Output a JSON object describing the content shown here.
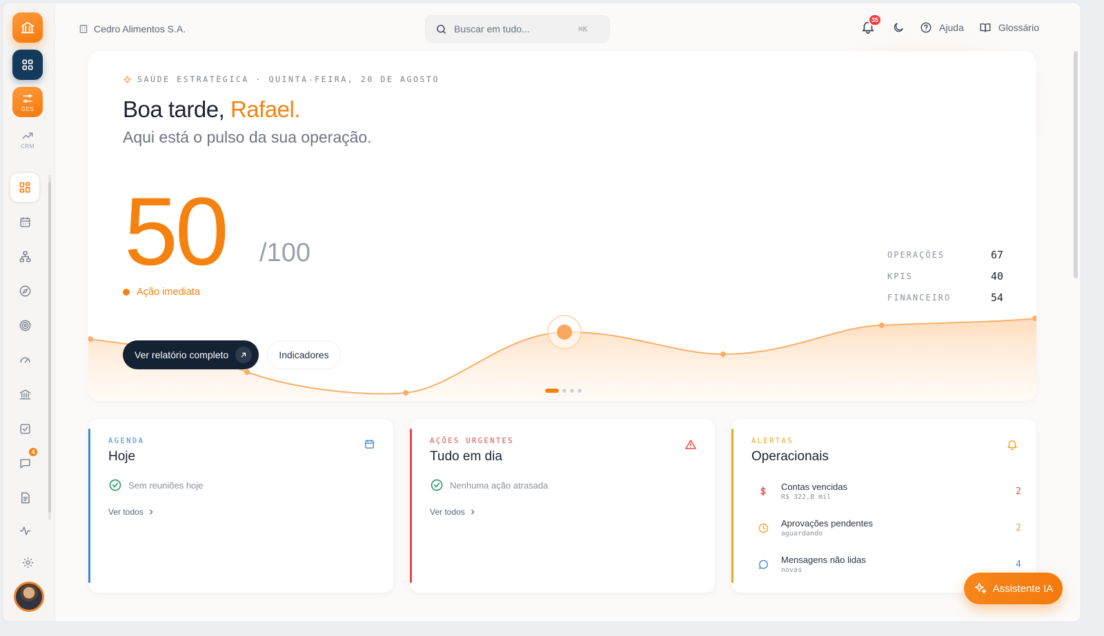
{
  "colors": {
    "accent": "#f5820f",
    "navy": "#163a5c",
    "agenda": "#3b8bd8",
    "urgent": "#e24a4a",
    "alerts": "#e8a72a",
    "success": "#2c9a6a"
  },
  "rail": {
    "ges_label": "GES",
    "crm_label": "CRM",
    "nav_items": [
      {
        "icon": "dashboard-icon"
      },
      {
        "icon": "calendar-icon"
      },
      {
        "icon": "org-chart-icon"
      },
      {
        "icon": "compass-icon"
      },
      {
        "icon": "target-icon"
      },
      {
        "icon": "gauge-icon"
      },
      {
        "icon": "bank-icon"
      },
      {
        "icon": "checkbox-icon"
      },
      {
        "icon": "chat-icon",
        "badge": "4"
      },
      {
        "icon": "document-icon"
      },
      {
        "icon": "activity-icon"
      }
    ]
  },
  "topbar": {
    "company": "Cedro Alimentos S.A.",
    "search_placeholder": "Buscar em tudo...",
    "search_shortcut": "⌘K",
    "notifications_count": "35",
    "help_label": "Ajuda",
    "glossary_label": "Glossário"
  },
  "hero": {
    "eyebrow": "SAÚDE ESTRATÉGICA · QUINTA-FEIRA, 20 DE AGOSTO",
    "greeting_prefix": "Boa tarde, ",
    "greeting_name": "Rafael.",
    "subtitle": "Aqui está o pulso da sua operação.",
    "score": "50",
    "score_max": "/100",
    "status": "Ação imediata",
    "metrics": [
      {
        "label": "OPERAÇÕES",
        "value": "67"
      },
      {
        "label": "KPIS",
        "value": "40"
      },
      {
        "label": "FINANCEIRO",
        "value": "54"
      }
    ],
    "primary_button": "Ver relatório completo",
    "secondary_button": "Indicadores",
    "carousel": {
      "count": 4,
      "active": 0
    }
  },
  "cards": {
    "agenda": {
      "eyebrow": "AGENDA",
      "title": "Hoje",
      "empty": "Sem reuniões hoje",
      "view_all": "Ver todos"
    },
    "urgent": {
      "eyebrow": "AÇÕES URGENTES",
      "title": "Tudo em dia",
      "empty": "Nenhuma ação atrasada",
      "view_all": "Ver todos"
    },
    "alerts": {
      "eyebrow": "ALERTAS",
      "title": "Operacionais",
      "items": [
        {
          "title": "Contas vencidas",
          "sub": "R$ 322,8 mil",
          "count": "2",
          "icon": "dollar-icon",
          "color": "#e24a4a"
        },
        {
          "title": "Aprovações pendentes",
          "sub": "aguardando",
          "count": "2",
          "icon": "clock-icon",
          "color": "#e8a72a"
        },
        {
          "title": "Mensagens não lidas",
          "sub": "novas",
          "count": "4",
          "icon": "message-icon",
          "color": "#3b8bd8"
        }
      ]
    }
  },
  "assistant_label": "Assistente IA"
}
